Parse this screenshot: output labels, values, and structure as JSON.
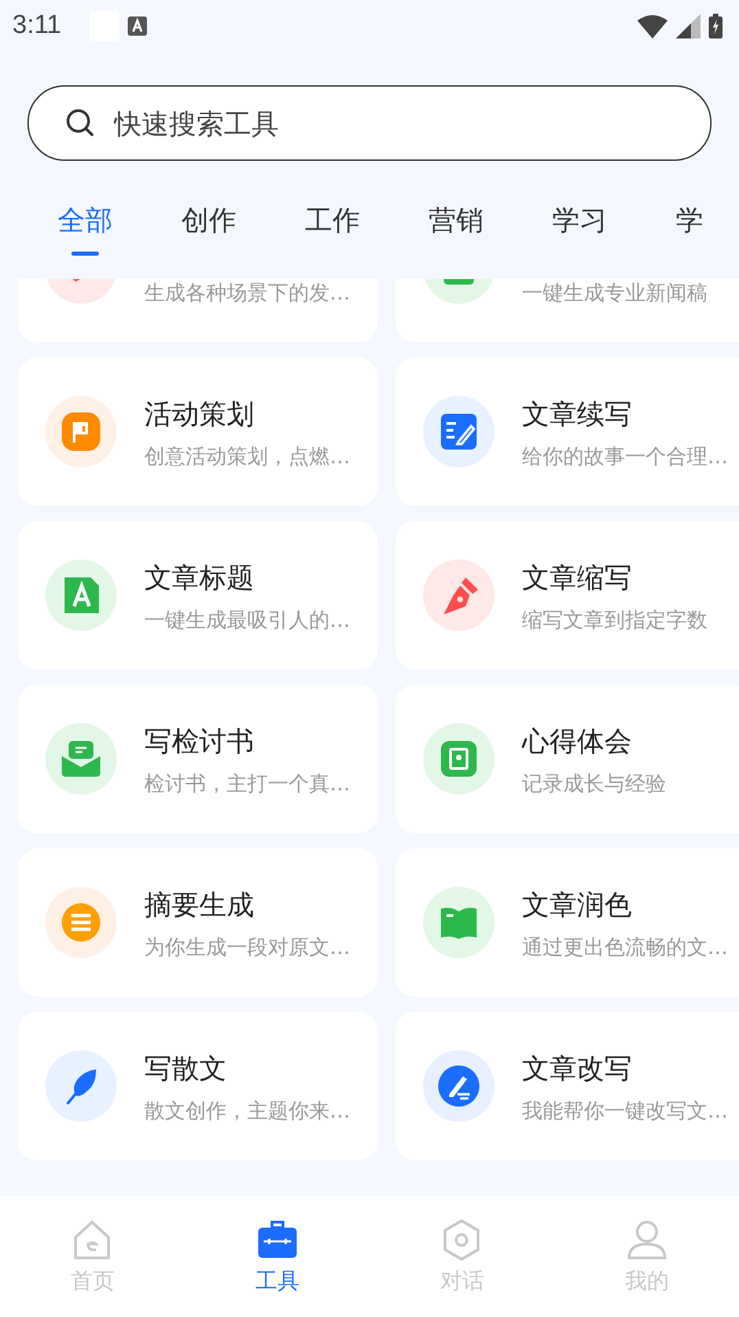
{
  "status_bar": {
    "time": "3:11"
  },
  "search": {
    "placeholder": "快速搜索工具"
  },
  "tabs": [
    {
      "label": "全部",
      "selected": true
    },
    {
      "label": "创作",
      "selected": false
    },
    {
      "label": "工作",
      "selected": false
    },
    {
      "label": "营销",
      "selected": false
    },
    {
      "label": "学习",
      "selected": false
    },
    {
      "label": "学",
      "selected": false
    }
  ],
  "tools": [
    {
      "subtitle": "生成各种场景下的发…"
    },
    {
      "subtitle": "一键生成专业新闻稿"
    },
    {
      "title": "活动策划",
      "subtitle": "创意活动策划，点燃…"
    },
    {
      "title": "文章续写",
      "subtitle": "给你的故事一个合理…"
    },
    {
      "title": "文章标题",
      "subtitle": "一键生成最吸引人的…"
    },
    {
      "title": "文章缩写",
      "subtitle": "缩写文章到指定字数"
    },
    {
      "title": "写检讨书",
      "subtitle": "检讨书，主打一个真…"
    },
    {
      "title": "心得体会",
      "subtitle": "记录成长与经验"
    },
    {
      "title": "摘要生成",
      "subtitle": "为你生成一段对原文…"
    },
    {
      "title": "文章润色",
      "subtitle": "通过更出色流畅的文…"
    },
    {
      "title": "写散文",
      "subtitle": "散文创作，主题你来…"
    },
    {
      "title": "文章改写",
      "subtitle": "我能帮你一键改写文…"
    }
  ],
  "nav": [
    {
      "label": "首页",
      "selected": false
    },
    {
      "label": "工具",
      "selected": true
    },
    {
      "label": "对话",
      "selected": false
    },
    {
      "label": "我的",
      "selected": false
    }
  ]
}
